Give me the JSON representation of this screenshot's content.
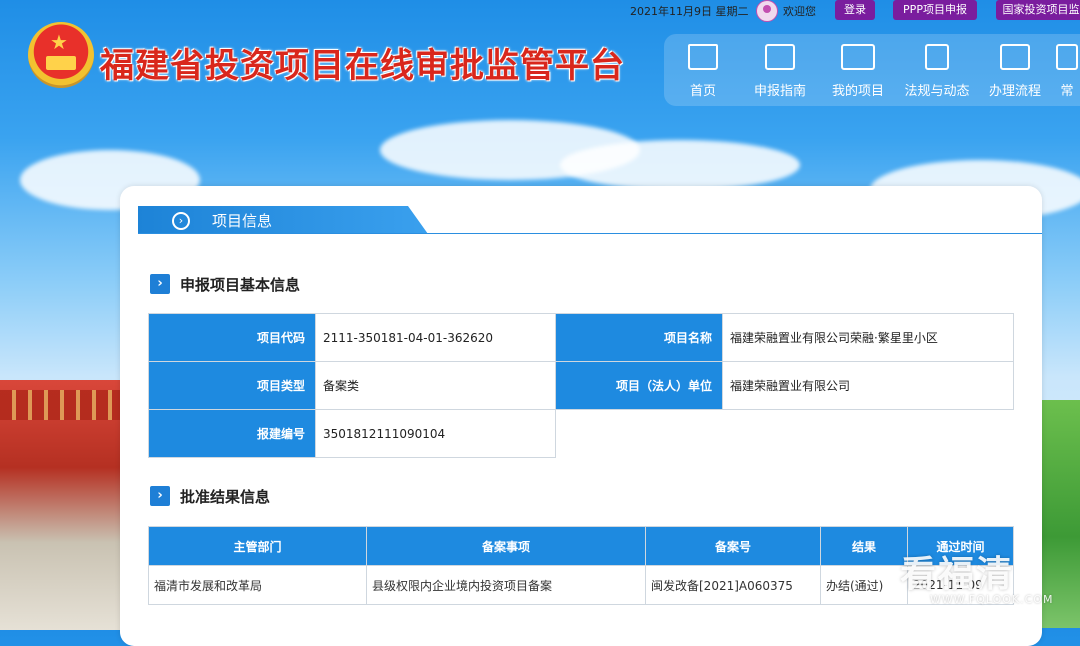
{
  "topbar": {
    "date": "2021年11月9日 星期二",
    "welcome": "欢迎您",
    "login": "登录",
    "ppp": "PPP项目申报",
    "national": "国家投资项目监"
  },
  "header": {
    "title": "福建省投资项目在线审批监管平台"
  },
  "nav": [
    {
      "label": "首页",
      "icon": "home-icon"
    },
    {
      "label": "申报指南",
      "icon": "guide-icon"
    },
    {
      "label": "我的项目",
      "icon": "projects-icon"
    },
    {
      "label": "法规与动态",
      "icon": "building-icon"
    },
    {
      "label": "办理流程",
      "icon": "process-icon"
    },
    {
      "label": "常",
      "icon": "faq-icon"
    }
  ],
  "panel": {
    "tab_title": "项目信息"
  },
  "basic": {
    "title": "申报项目基本信息",
    "rows": [
      {
        "l1": "项目代码",
        "v1": "2111-350181-04-01-362620",
        "l2": "项目名称",
        "v2": "福建荣融置业有限公司荣融·繁星里小区"
      },
      {
        "l1": "项目类型",
        "v1": "备案类",
        "l2": "项目（法人）单位",
        "v2": "福建荣融置业有限公司"
      },
      {
        "l1": "报建编号",
        "v1": "3501812111090104"
      }
    ]
  },
  "result": {
    "title": "批准结果信息",
    "headers": [
      "主管部门",
      "备案事项",
      "备案号",
      "结果",
      "通过时间"
    ],
    "row": [
      "福清市发展和改革局",
      "县级权限内企业境内投资项目备案",
      "闽发改备[2021]A060375",
      "办结(通过)",
      "2021-11-09"
    ]
  },
  "watermark": {
    "main": "看福清",
    "sub": "WWW.FQLOOK.COM"
  },
  "colors": {
    "accent": "#1e8ae0",
    "title_red": "#d9271c",
    "button_purple": "#7a1d9e"
  }
}
